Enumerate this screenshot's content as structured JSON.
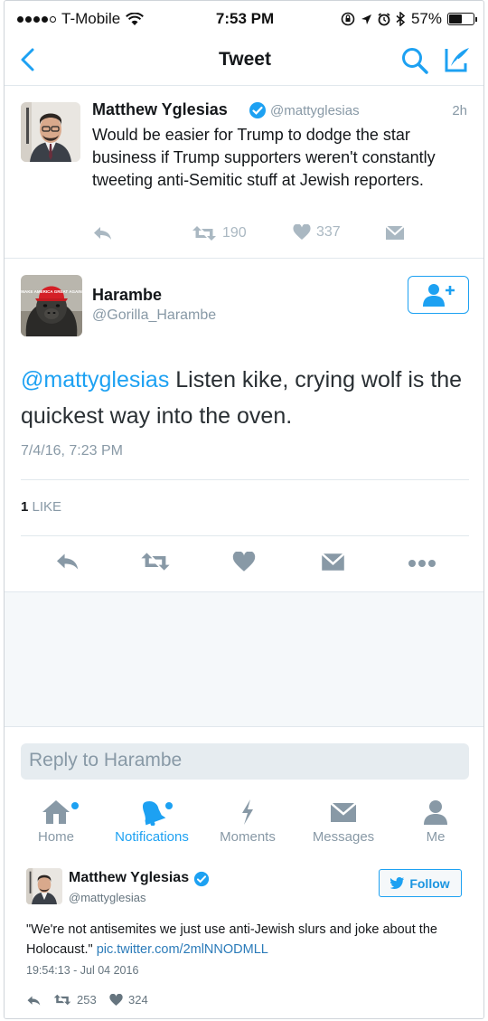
{
  "status_bar": {
    "carrier": "T-Mobile",
    "time": "7:53 PM",
    "battery": "57%",
    "battery_level": 0.57
  },
  "nav": {
    "title": "Tweet"
  },
  "parent_tweet": {
    "name": "Matthew Yglesias",
    "handle": "@mattyglesias",
    "age": "2h",
    "text": "Would be easier for Trump to dodge the star business if Trump supporters weren't constantly tweeting anti-Semitic stuff at Jewish reporters.",
    "retweets": "190",
    "likes": "337"
  },
  "main_tweet": {
    "name": "Harambe",
    "handle": "@Gorilla_Harambe",
    "mention": "@mattyglesias",
    "text": " Listen kike, crying wolf is the quickest way into the oven.",
    "date": "7/4/16, 7:23 PM",
    "like_count": "1",
    "like_label": "LIKE",
    "hat_text": "MAKE AMERICA GREAT AGAIN"
  },
  "reply": {
    "placeholder": "Reply to Harambe"
  },
  "tabs": [
    {
      "label": "Home",
      "icon": "home-icon",
      "active": false
    },
    {
      "label": "Notifications",
      "icon": "bell-icon",
      "active": true
    },
    {
      "label": "Moments",
      "icon": "lightning-icon",
      "active": false
    },
    {
      "label": "Messages",
      "icon": "envelope-icon",
      "active": false
    },
    {
      "label": "Me",
      "icon": "person-icon",
      "active": false
    }
  ],
  "embed": {
    "name": "Matthew Yglesias",
    "handle": "@mattyglesias",
    "follow_label": "Follow",
    "text": "\"We're not antisemites we just use anti-Jewish slurs and joke about the Holocaust.\" ",
    "link": "pic.twitter.com/2mlNNODMLL",
    "timestamp": "19:54:13 - Jul 04 2016",
    "retweets": "253",
    "likes": "324"
  },
  "colors": {
    "accent": "#1da1f2",
    "muted": "#8899a6",
    "divider": "#e1e8ed"
  }
}
